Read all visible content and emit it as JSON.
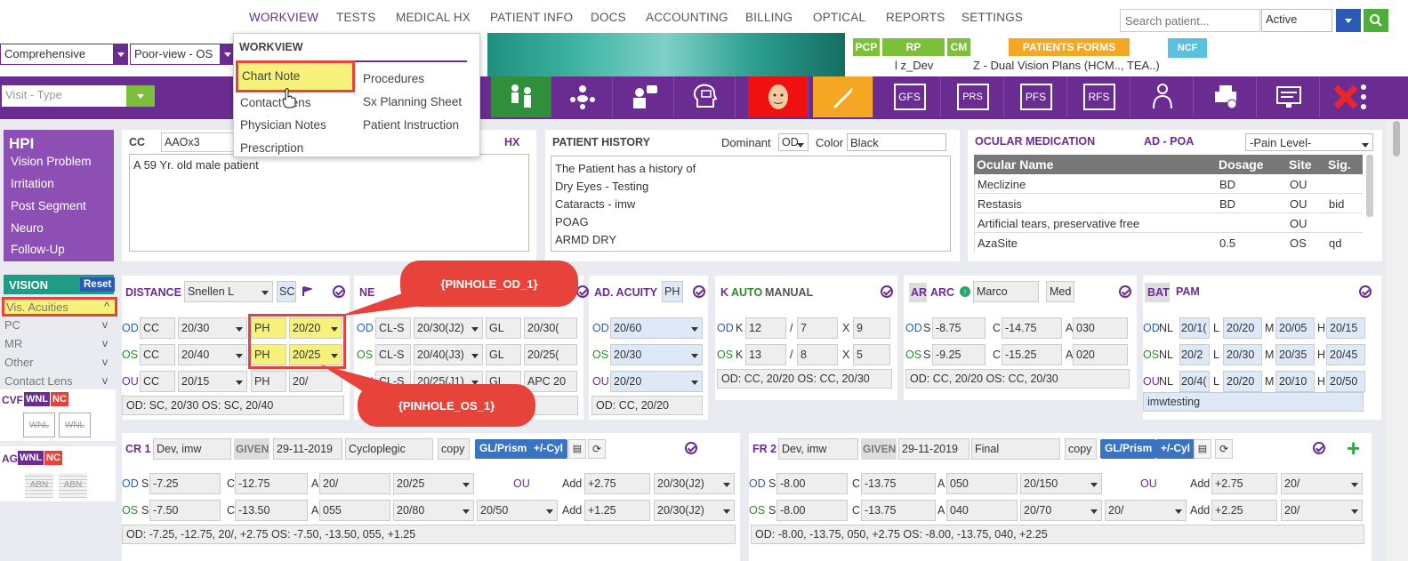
{
  "nav": {
    "items": [
      "WORKVIEW",
      "TESTS",
      "MEDICAL HX",
      "PATIENT INFO",
      "DOCS",
      "ACCOUNTING",
      "BILLING",
      "OPTICAL",
      "REPORTS",
      "SETTINGS"
    ],
    "search_placeholder": "Search patient...",
    "status": "Active"
  },
  "toolbar": {
    "exam_type": "Comprehensive",
    "view": "Poor-view - OS",
    "visit_type_placeholder": "Visit - Type"
  },
  "badges": {
    "pcp": "PCP",
    "rp": "RP",
    "cm": "CM",
    "patients_forms": "PATIENTS FORMS",
    "ncf": "NCF",
    "user": "l z_Dev",
    "plan": "Z - Dual Vision Plans (HCM.., TEA..)"
  },
  "icon_labels": {
    "gfs": "GFS",
    "prs": "PRS",
    "pfs": "PFS",
    "rfs": "RFS"
  },
  "menu": {
    "title": "WORKVIEW",
    "left": [
      "Chart Note",
      "Contact Lens",
      "Physician Notes",
      "Prescription"
    ],
    "right": [
      "Procedures",
      "Sx Planning Sheet",
      "Patient Instruction"
    ]
  },
  "hpi": {
    "title": "HPI",
    "items": [
      "Vision Problem",
      "Irritation",
      "Post Segment",
      "Neuro",
      "Follow-Up"
    ]
  },
  "cc": {
    "label": "CC",
    "value": "AAOx3",
    "hx": "HX",
    "text": "A 59 Yr. old male patient"
  },
  "history": {
    "title": "PATIENT HISTORY",
    "dominant_label": "Dominant",
    "dominant": "OD",
    "color_label": "Color",
    "color": "Black",
    "lines": [
      "The Patient has a history of",
      "Dry Eyes - Testing",
      "Cataracts - imw",
      "POAG",
      "ARMD DRY"
    ]
  },
  "ocular": {
    "title": "OCULAR MEDICATION",
    "ad": "AD - POA",
    "pain": "-Pain Level-",
    "headers": [
      "Ocular Name",
      "Dosage",
      "Site",
      "Sig."
    ],
    "rows": [
      [
        "Meclizine",
        "BD",
        "OU",
        ""
      ],
      [
        "Restasis",
        "BD",
        "OU",
        "bid"
      ],
      [
        "Artificial tears, preservative free",
        "",
        "OU",
        ""
      ],
      [
        "AzaSite",
        "0.5",
        "OS",
        "qd"
      ]
    ]
  },
  "vision": {
    "title": "VISION",
    "reset": "Reset",
    "items": [
      "Vis. Acuities",
      "PC",
      "MR",
      "Other",
      "Contact Lens"
    ],
    "cvf": "CVF",
    "ag": "AG",
    "wnl": "WNL",
    "nc": "NC",
    "abn": "ABN"
  },
  "distance": {
    "title": "DISTANCE",
    "method": "Snellen L",
    "sc": "SC",
    "rows": [
      [
        "OD",
        "CC",
        "20/30",
        "PH",
        "20/20"
      ],
      [
        "OS",
        "CC",
        "20/40",
        "PH",
        "20/25"
      ],
      [
        "OU",
        "CC",
        "20/15",
        "PH",
        "20/"
      ]
    ],
    "summary": "OD: SC, 20/30 OS: SC, 20/40"
  },
  "near": {
    "title": "NE",
    "rows": [
      [
        "OD",
        "CL-S",
        "20/30(J2)",
        "GL",
        "20/30("
      ],
      [
        "OS",
        "CL-S",
        "20/40(J3)",
        "GL",
        "20/25("
      ],
      [
        "OU",
        "CL-S",
        "20/25(J1)",
        "GL",
        "APC 20"
      ]
    ]
  },
  "ad_acuity": {
    "title": "AD. ACUITY",
    "ph": "PH",
    "rows": [
      [
        "OD",
        "20/60"
      ],
      [
        "OS",
        "20/30"
      ],
      [
        "OU",
        "20/20"
      ]
    ],
    "summary": "OD: CC, 20/20"
  },
  "k": {
    "k": "K",
    "auto": "AUTO",
    "manual": "MANUAL",
    "rows": [
      [
        "OD",
        "K",
        "12",
        "7",
        "X",
        "9"
      ],
      [
        "OS",
        "K",
        "13",
        "8",
        "X",
        "5"
      ]
    ],
    "summary": "OD: CC, 20/20 OS: CC, 20/30"
  },
  "ar": {
    "ar": "AR",
    "arc": "ARC",
    "name": "Marco",
    "med": "Med",
    "rows": [
      [
        "OD",
        "S",
        "-8.75",
        "C",
        "-14.75",
        "A",
        "030"
      ],
      [
        "OS",
        "S",
        "-9.25",
        "C",
        "-15.25",
        "A",
        "020"
      ]
    ],
    "summary": "OD: CC, 20/20 OS: CC, 20/30"
  },
  "bat": {
    "bat": "BAT",
    "pam": "PAM",
    "rows": [
      [
        "OD",
        "NL",
        "20/1(",
        "L",
        "20/20",
        "M",
        "20/05",
        "H",
        "20/15"
      ],
      [
        "OS",
        "NL",
        "20/2",
        "L",
        "20/30",
        "M",
        "20/35",
        "H",
        "20/45"
      ],
      [
        "OU",
        "NL",
        "20/4(",
        "L",
        "20/20",
        "M",
        "20/10",
        "H",
        "20/50"
      ]
    ],
    "note": "imwtesting"
  },
  "cr": {
    "title": "CR 1",
    "by": "Dev, imw",
    "given": "GIVEN",
    "date": "29-11-2019",
    "type": "Cycloplegic",
    "copy": "copy",
    "gl": "GL/Prism",
    "cyl": "+/-Cyl",
    "ou": "OU",
    "od": [
      "OD",
      "S",
      "-7.25",
      "C",
      "-12.75",
      "A",
      "20/",
      "20/25",
      "Add",
      "+2.75",
      "20/30(J2)"
    ],
    "os": [
      "OS",
      "S",
      "-7.50",
      "C",
      "-13.50",
      "A",
      "055",
      "20/80",
      "20/50",
      "Add",
      "+1.25",
      "20/30(J2)"
    ],
    "summary": "OD: -7.25, -12.75, 20/, +2.75 OS: -7.50, -13.50, 055, +1.25"
  },
  "fr": {
    "title": "FR 2",
    "by": "Dev, imw",
    "given": "GIVEN",
    "date": "29-11-2019",
    "type": "Final",
    "copy": "copy",
    "gl": "GL/Prism",
    "cyl": "+/-Cyl",
    "ou": "OU",
    "od": [
      "OD",
      "S",
      "-8.00",
      "C",
      "-13.75",
      "A",
      "050",
      "20/150",
      "Add",
      "+2.75",
      "20/"
    ],
    "os": [
      "OS",
      "S",
      "-8.00",
      "C",
      "-13.75",
      "A",
      "040",
      "20/70",
      "20/",
      "Add",
      "+2.25",
      "20/"
    ],
    "summary": "OD: -8.00, -13.75, 050, +2.75 OS: -8.00, -13.75, 040, +2.25"
  },
  "callouts": {
    "od": "{PINHOLE_OD_1}",
    "os": "{PINHOLE_OS_1}"
  }
}
